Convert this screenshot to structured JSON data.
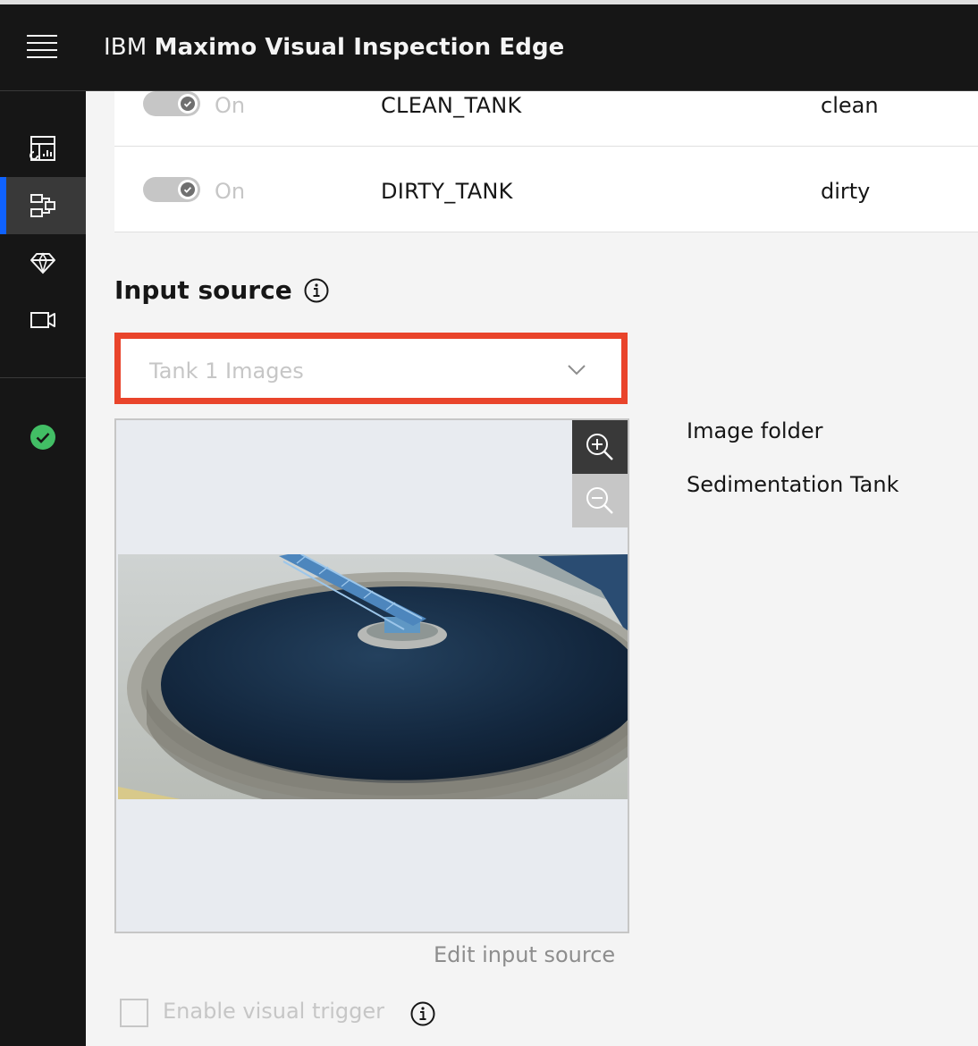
{
  "header": {
    "brand_prefix": "IBM",
    "brand_name": "Maximo Visual Inspection Edge"
  },
  "sidenav": {
    "items": [
      {
        "icon": "dashboard-icon",
        "active": false
      },
      {
        "icon": "inspection-flow-icon",
        "active": true
      },
      {
        "icon": "model-diamond-icon",
        "active": false
      },
      {
        "icon": "video-camera-icon",
        "active": false
      }
    ],
    "status_icon": "checkmark-filled-icon",
    "status_color": "#42be65",
    "accent_color": "#0f62fe"
  },
  "rules": [
    {
      "toggle_state": "On",
      "class_name": "CLEAN_TANK",
      "label": "clean"
    },
    {
      "toggle_state": "On",
      "class_name": "DIRTY_TANK",
      "label": "dirty"
    }
  ],
  "input_source": {
    "title": "Input source",
    "selected": "Tank 1 Images",
    "highlight_color": "#e9442b",
    "details": [
      "Image folder",
      "Sedimentation Tank"
    ],
    "edit_label": "Edit input source"
  },
  "visual_trigger": {
    "label": "Enable visual trigger",
    "checked": false
  }
}
